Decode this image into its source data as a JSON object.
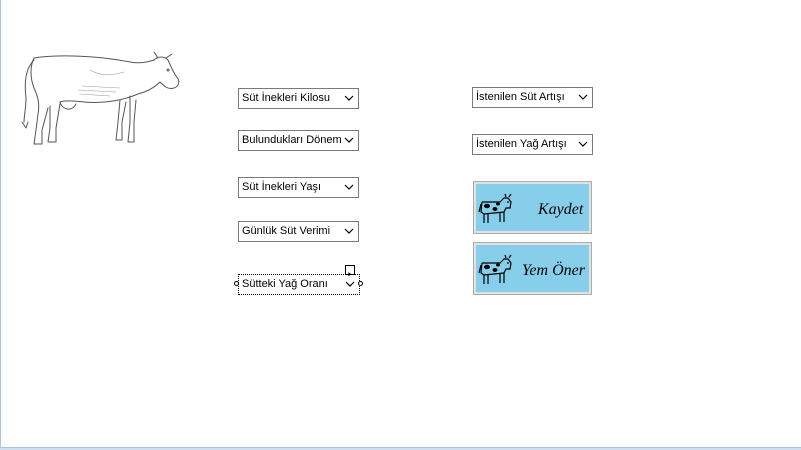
{
  "form": {
    "combos_left": [
      {
        "name": "combo-sut-inekleri-kilosu",
        "text": "Süt İnekleri Kilosu"
      },
      {
        "name": "combo-bulunduklari-donem",
        "text": "Bulundukları Dönem"
      },
      {
        "name": "combo-sut-inekleri-yasi",
        "text": "Süt İnekleri Yaşı"
      },
      {
        "name": "combo-gunluk-sut-verimi",
        "text": "Günlük Süt Verimi"
      },
      {
        "name": "combo-sutteki-yag-orani",
        "text": "Sütteki Yağ Oranı"
      }
    ],
    "combos_right": [
      {
        "name": "combo-istenilen-sut-artisi",
        "text": "İstenilen Süt Artışı"
      },
      {
        "name": "combo-istenilen-yag-artisi",
        "text": "İstenilen Yağ Artışı"
      }
    ],
    "buttons": {
      "save_label": "Kaydet",
      "suggest_label": "Yem Öner"
    }
  },
  "colors": {
    "button_face": "#87ceeb",
    "window_frame": "#a9c4e4"
  },
  "icons": [
    "cow-drawing",
    "chevron-down-icon",
    "cow-icon",
    "smart-tag-arrow-icon"
  ]
}
